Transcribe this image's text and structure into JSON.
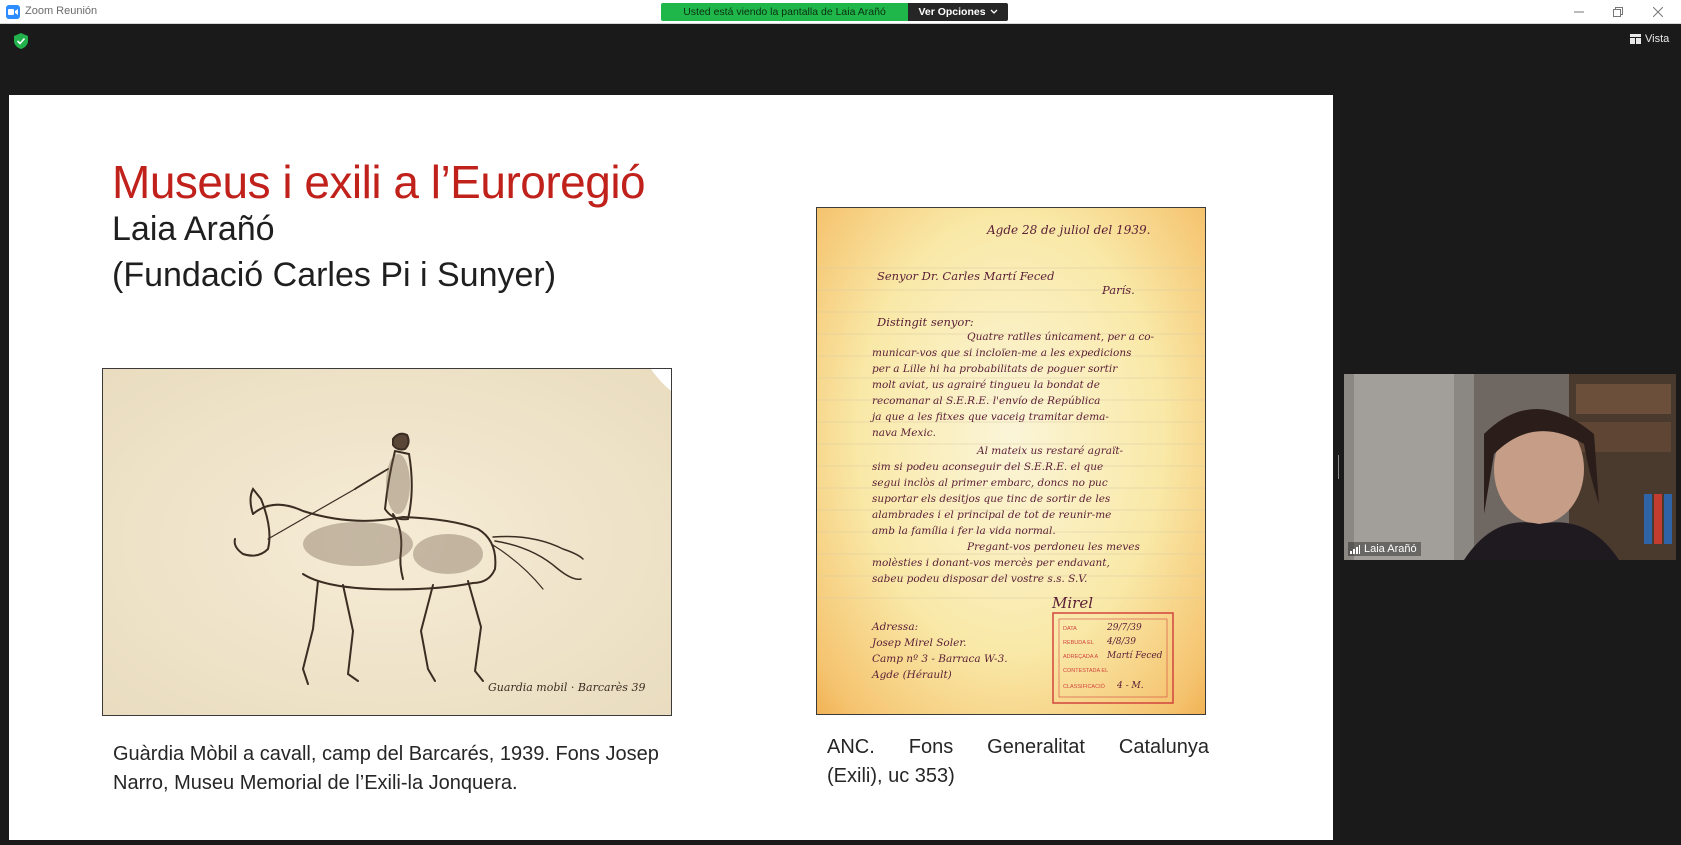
{
  "window": {
    "title": "Zoom Reunión",
    "share_banner": "Usted está viendo la pantalla de Laia Arañó",
    "view_options": "Ver Opciones"
  },
  "toolbar": {
    "view_label": "Vista"
  },
  "slide": {
    "title": "Museus i exili a l’Euroregió",
    "author": "Laia Arañó",
    "organization": "(Fundació Carles Pi i Sunyer)",
    "caption_left": "Guàrdia Mòbil a cavall, camp del Barcarés, 1939. Fons Josep Narro, Museu Memorial de l’Exili-la Jonquera.",
    "caption_right_line1": [
      "ANC.",
      "Fons",
      "Generalitat",
      "Catalunya"
    ],
    "caption_right_line2": "(Exili), uc 353)",
    "drawing_signature": "Guardia mobil · Barcarès 39",
    "letter": {
      "date": "Agde 28 de juliol del 1939.",
      "salutation": "Senyor Dr. Carles Martí Feced",
      "city": "París.",
      "greeting": "Distingit senyor:",
      "body": [
        "Quatre ratlles únicament, per a co-",
        "municar-vos que si incloïen-me a les expedicions",
        "per a Lille hi ha probabilitats de poguer sortir",
        "molt aviat, us agrairé tingueu la bondat de",
        "recomanar al S.E.R.E. l'envío de República",
        "ja que a les fitxes que vaceig tramitar dema-",
        "nava Mexic.",
        "Al mateix us restaré agraït-",
        "sim si podeu aconseguir del S.E.R.E. el que",
        "segui inclòs al primer embarc, doncs no puc",
        "suportar els desitjos que tinc de sortir de les",
        "alambrades i el principal de tot de reunir-me",
        "amb la família i fer la vida normal.",
        "Pregant-vos perdoneu les meves",
        "molèsties i donant-vos mercès per endavant,",
        "sabeu podeu disposar del vostre s.s. S.V."
      ],
      "signature": "Mirel",
      "address_label": "Adressa:",
      "address": [
        "Josep Mirel Soler.",
        "Camp nº 3 - Barraca W-3.",
        "Agde (Hérault)"
      ],
      "stamp": {
        "data_label": "DATA",
        "data_value": "29/7/39",
        "rebuda_label": "REBUDA EL",
        "rebuda_value": "4/8/39",
        "adrecada_label": "ADREÇADA A",
        "adrecada_value": "Martí Feced",
        "contestada_label": "CONTESTADA EL",
        "classificacio_label": "CLASSIFICACIÓ",
        "classificacio_value": "4 - M."
      }
    }
  },
  "participant": {
    "name": "Laia Arañó"
  },
  "colors": {
    "title_red": "#c0211b",
    "banner_green": "#1fb74a",
    "zoom_blue": "#2d8cff",
    "background": "#1a1a1a"
  },
  "icons": [
    "zoom-app-icon",
    "minimize-icon",
    "restore-icon",
    "close-icon",
    "shield-check-icon",
    "grid-view-icon",
    "chevron-down-icon",
    "signal-bars-icon"
  ]
}
